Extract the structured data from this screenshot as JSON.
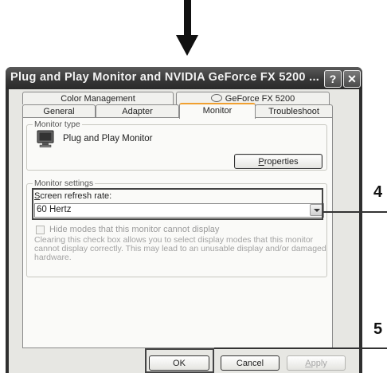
{
  "window": {
    "title": "Plug and Play Monitor and NVIDIA GeForce FX 5200 ...",
    "help_label": "?",
    "close_label": "✕"
  },
  "tabs": {
    "row1": [
      "Color Management",
      "GeForce FX 5200"
    ],
    "row2": [
      "General",
      "Adapter",
      "Monitor",
      "Troubleshoot"
    ],
    "active": "Monitor"
  },
  "monitor_type": {
    "legend": "Monitor type",
    "name": "Plug and Play Monitor",
    "properties_label": "Properties",
    "properties_mnemonic": "P",
    "properties_rest": "roperties"
  },
  "monitor_settings": {
    "legend": "Monitor settings",
    "refresh_mnemonic": "S",
    "refresh_rest": "creen refresh rate:",
    "refresh_value": "60 Hertz",
    "hide_label": "Hide modes that this monitor cannot display",
    "description": "Clearing this check box allows you to select display modes that this monitor cannot display correctly. This may lead to an unusable display and/or damaged hardware."
  },
  "buttons": {
    "ok": "OK",
    "cancel": "Cancel",
    "apply_mnemonic": "A",
    "apply_rest": "pply"
  },
  "callouts": [
    "4",
    "5"
  ]
}
